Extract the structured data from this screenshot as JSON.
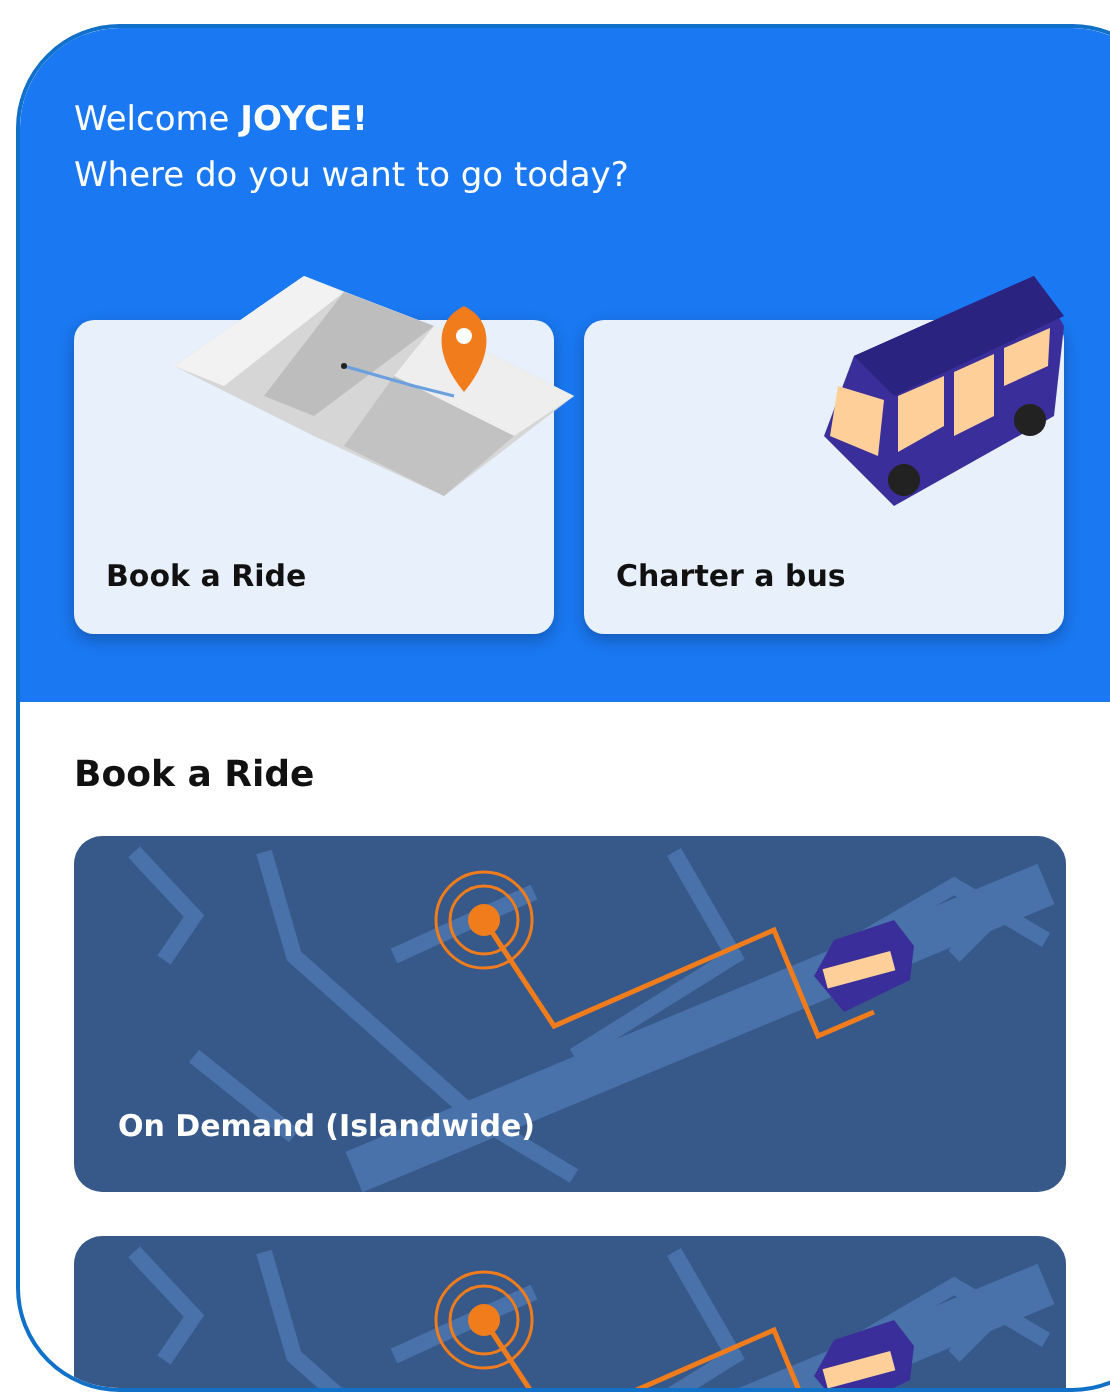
{
  "header": {
    "greeting": "Welcome **JOYCE!**",
    "question": "Where do you want to go today?"
  },
  "options": [
    {
      "label": "Book a Ride",
      "kind": "map"
    },
    {
      "label": "Charter a bus",
      "kind": "bus"
    }
  ],
  "section": {
    "title": "Book a Ride"
  },
  "services": [
    {
      "label": "On Demand (Islandwide)",
      "kind": "route"
    },
    {
      "kind": "route"
    }
  ]
}
